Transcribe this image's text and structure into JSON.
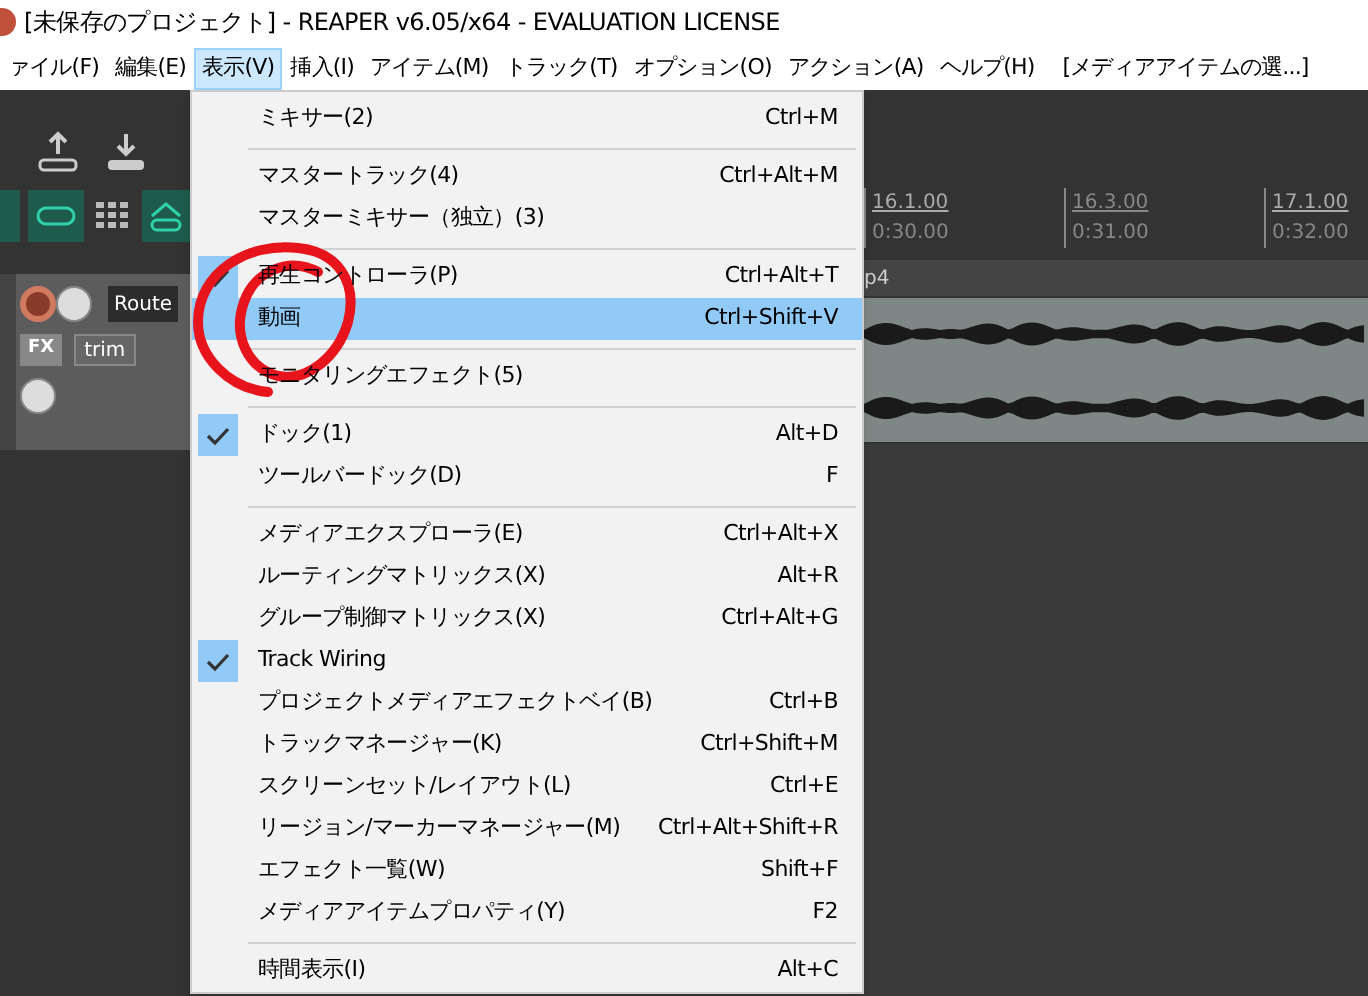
{
  "window": {
    "title": "[未保存のプロジェクト] - REAPER v6.05/x64 - EVALUATION LICENSE"
  },
  "menubar": [
    {
      "label": "ァイル(F)",
      "selected": false
    },
    {
      "label": "編集(E)",
      "selected": false
    },
    {
      "label": "表示(V)",
      "selected": true
    },
    {
      "label": "挿入(I)",
      "selected": false
    },
    {
      "label": "アイテム(M)",
      "selected": false
    },
    {
      "label": "トラック(T)",
      "selected": false
    },
    {
      "label": "オプション(O)",
      "selected": false
    },
    {
      "label": "アクション(A)",
      "selected": false
    },
    {
      "label": "ヘルプ(H)",
      "selected": false
    },
    {
      "label": "[メディアアイテムの選...]",
      "selected": false
    }
  ],
  "track": {
    "route": "Route",
    "fx": "FX",
    "trim": "trim",
    "name": "p4"
  },
  "ruler": [
    {
      "bar": "16.1.00",
      "time": "0:30.00",
      "major": true
    },
    {
      "bar": "16.3.00",
      "time": "0:31.00",
      "major": false
    },
    {
      "bar": "17.1.00",
      "time": "0:32.00",
      "major": true
    }
  ],
  "menu": [
    {
      "kind": "item",
      "label": "ミキサー(2)",
      "shortcut": "Ctrl+M",
      "checked": false,
      "selected": false
    },
    {
      "kind": "separator"
    },
    {
      "kind": "item",
      "label": "マスタートラック(4)",
      "shortcut": "Ctrl+Alt+M",
      "checked": false,
      "selected": false
    },
    {
      "kind": "item",
      "label": "マスターミキサー（独立）(3)",
      "checked": false,
      "selected": false
    },
    {
      "kind": "separator"
    },
    {
      "kind": "item",
      "label": "再生コントローラ(P)",
      "shortcut": "Ctrl+Alt+T",
      "checked": true,
      "selected": false
    },
    {
      "kind": "item",
      "label": "動画",
      "shortcut": "Ctrl+Shift+V",
      "checked": false,
      "selected": true
    },
    {
      "kind": "separator"
    },
    {
      "kind": "item",
      "label": "モニタリングエフェクト(5)",
      "checked": false,
      "selected": false
    },
    {
      "kind": "separator"
    },
    {
      "kind": "item",
      "label": "ドック(1)",
      "shortcut": "Alt+D",
      "checked": true,
      "selected": false
    },
    {
      "kind": "item",
      "label": "ツールバードック(D)",
      "shortcut": "F",
      "checked": false,
      "selected": false
    },
    {
      "kind": "separator"
    },
    {
      "kind": "item",
      "label": "メディアエクスプローラ(E)",
      "shortcut": "Ctrl+Alt+X",
      "checked": false,
      "selected": false
    },
    {
      "kind": "item",
      "label": "ルーティングマトリックス(X)",
      "shortcut": "Alt+R",
      "checked": false,
      "selected": false
    },
    {
      "kind": "item",
      "label": "グループ制御マトリックス(X)",
      "shortcut": "Ctrl+Alt+G",
      "checked": false,
      "selected": false
    },
    {
      "kind": "item",
      "label": "Track Wiring",
      "checked": true,
      "selected": false
    },
    {
      "kind": "item",
      "label": "プロジェクトメディアエフェクトベイ(B)",
      "shortcut": "Ctrl+B",
      "checked": false,
      "selected": false
    },
    {
      "kind": "item",
      "label": "トラックマネージャー(K)",
      "shortcut": "Ctrl+Shift+M",
      "checked": false,
      "selected": false
    },
    {
      "kind": "item",
      "label": "スクリーンセット/レイアウト(L)",
      "shortcut": "Ctrl+E",
      "checked": false,
      "selected": false
    },
    {
      "kind": "item",
      "label": "リージョン/マーカーマネージャー(M)",
      "shortcut": "Ctrl+Alt+Shift+R",
      "checked": false,
      "selected": false
    },
    {
      "kind": "item",
      "label": "エフェクト一覧(W)",
      "shortcut": "Shift+F",
      "checked": false,
      "selected": false
    },
    {
      "kind": "item",
      "label": "メディアアイテムプロパティ(Y)",
      "shortcut": "F2",
      "checked": false,
      "selected": false
    },
    {
      "kind": "separator"
    },
    {
      "kind": "item",
      "label": "時間表示(I)",
      "shortcut": "Alt+C",
      "checked": false,
      "selected": false
    }
  ]
}
